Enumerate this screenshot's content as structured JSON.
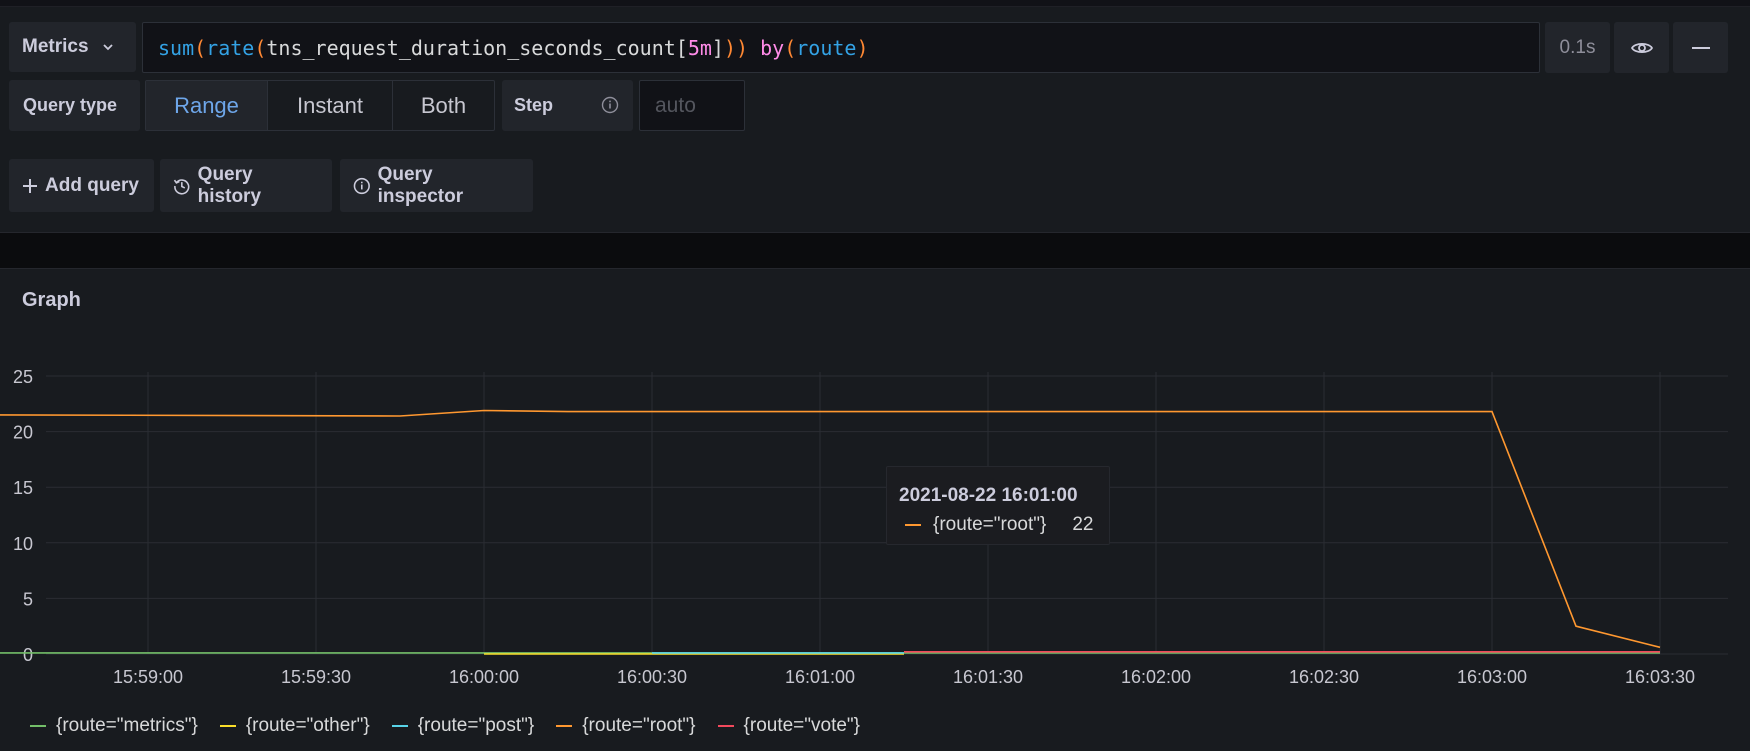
{
  "query_row": {
    "mode_button": "Metrics",
    "query_tokens": [
      {
        "text": "sum",
        "cls": "tok-fn"
      },
      {
        "text": "(",
        "cls": "tok-paren"
      },
      {
        "text": "rate",
        "cls": "tok-fn"
      },
      {
        "text": "(",
        "cls": "tok-paren"
      },
      {
        "text": "tns_request_duration_seconds_count[",
        "cls": "tok-text"
      },
      {
        "text": "5m",
        "cls": "tok-num"
      },
      {
        "text": "]",
        "cls": "tok-text"
      },
      {
        "text": "))",
        "cls": "tok-paren"
      },
      {
        "text": " ",
        "cls": "tok-text"
      },
      {
        "text": "by",
        "cls": "tok-kw"
      },
      {
        "text": "(",
        "cls": "tok-paren"
      },
      {
        "text": "route",
        "cls": "tok-fn"
      },
      {
        "text": ")",
        "cls": "tok-paren"
      }
    ],
    "duration": "0.1s"
  },
  "options_row": {
    "query_type_label": "Query type",
    "query_types": [
      "Range",
      "Instant",
      "Both"
    ],
    "selected_query_type": "Range",
    "step_label": "Step",
    "step_placeholder": "auto"
  },
  "actions": {
    "add_query": "Add query",
    "query_history": "Query history",
    "query_inspector": "Query inspector"
  },
  "graph": {
    "title": "Graph",
    "tooltip": {
      "time": "2021-08-22 16:01:00",
      "series": "{route=\"root\"}",
      "value": "22"
    }
  },
  "colors": {
    "metrics": "#73bf69",
    "other": "#fade2a",
    "post": "#5794f2",
    "post_display": "#58d4e8",
    "root": "#ff9830",
    "vote": "#f2495c"
  },
  "chart_data": {
    "type": "line",
    "x_ticks": [
      "15:59:00",
      "15:59:30",
      "16:00:00",
      "16:00:30",
      "16:01:00",
      "16:01:30",
      "16:02:00",
      "16:02:30",
      "16:03:00",
      "16:03:30"
    ],
    "y_ticks": [
      0,
      5,
      10,
      15,
      20,
      25
    ],
    "ylim": [
      0,
      25
    ],
    "x_range_seconds_from_first_tick": [
      -30,
      30
    ],
    "series": [
      {
        "name": "{route=\"metrics\"}",
        "color": "#73bf69",
        "points": [
          [
            -30,
            0.1
          ],
          [
            270,
            0.1
          ]
        ]
      },
      {
        "name": "{route=\"other\"}",
        "color": "#fade2a",
        "points": [
          [
            60,
            0.0
          ],
          [
            135,
            0.0
          ]
        ]
      },
      {
        "name": "{route=\"post\"}",
        "color": "#58d4e8",
        "points": [
          [
            90,
            0.1
          ],
          [
            135,
            0.1
          ]
        ]
      },
      {
        "name": "{route=\"root\"}",
        "color": "#ff9830",
        "points": [
          [
            -30,
            21.1
          ],
          [
            -27,
            21.5
          ],
          [
            45,
            21.4
          ],
          [
            60,
            21.9
          ],
          [
            75,
            21.8
          ],
          [
            240,
            21.8
          ],
          [
            255,
            2.5
          ],
          [
            270,
            0.6
          ]
        ]
      },
      {
        "name": "{route=\"vote\"}",
        "color": "#f2495c",
        "points": [
          [
            135,
            0.2
          ],
          [
            270,
            0.2
          ]
        ]
      }
    ]
  }
}
